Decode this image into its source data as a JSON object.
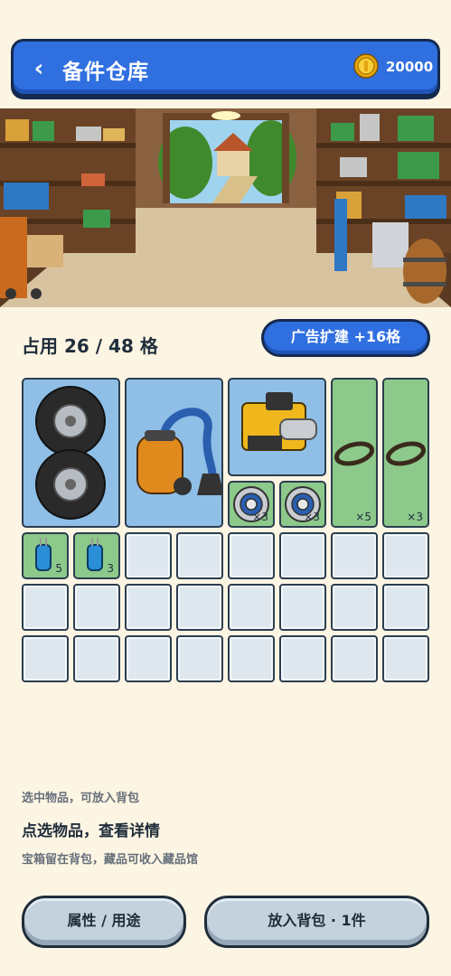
{
  "header": {
    "back_glyph": "‹",
    "title": "备件仓库",
    "coins": "20000",
    "coin_icon": "gold-coin-icon"
  },
  "storage": {
    "occupancy": "占用 26 / 48 格",
    "expand_button": "广告扩建 +16格"
  },
  "items": {
    "tires": {
      "name": "tires",
      "qty": ""
    },
    "vacuum": {
      "name": "vacuum",
      "qty": ""
    },
    "engine": {
      "name": "engine",
      "qty": ""
    },
    "belt1": {
      "name": "belt",
      "qty": "×5"
    },
    "belt2": {
      "name": "belt",
      "qty": "×3"
    },
    "bearing1": {
      "name": "bearing",
      "qty": "×3"
    },
    "bearing2": {
      "name": "bearing",
      "qty": "×3"
    },
    "capacitor1": {
      "name": "capacitor",
      "qty": "5"
    },
    "capacitor2": {
      "name": "capacitor",
      "qty": "3"
    }
  },
  "hints": {
    "line1": "选中物品，可放入背包",
    "line2": "点选物品，查看详情",
    "line3": "宝箱留在背包，藏品可收入藏品馆"
  },
  "buttons": {
    "attributes": "属性 / 用途",
    "put_in_bag": "放入背包 · 1件"
  },
  "colors": {
    "accent": "#2f6fe0",
    "item_blue": "#8fbfe6",
    "item_green": "#8cc98a",
    "background": "#fdf5e3"
  }
}
